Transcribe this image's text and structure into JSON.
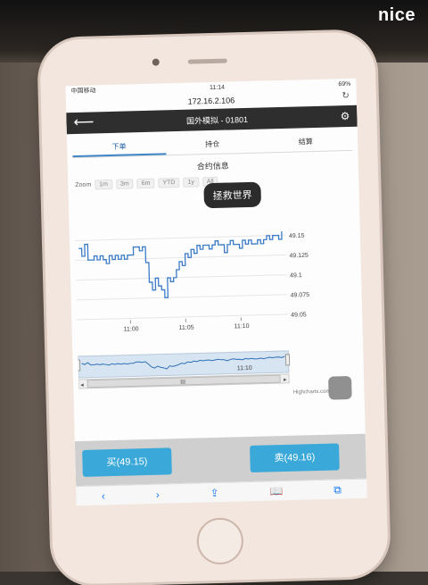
{
  "overlay": {
    "nice_label": "nice"
  },
  "status": {
    "carrier": "中国移动",
    "time": "11:14",
    "battery": "69%"
  },
  "browser": {
    "url": "172.16.2.106"
  },
  "app": {
    "title": "国外模拟 - 01801",
    "back_icon": "arrow-left-icon",
    "settings_icon": "gear-icon"
  },
  "tabs": [
    {
      "label": "下单",
      "active": true
    },
    {
      "label": "持仓",
      "active": false
    },
    {
      "label": "结算",
      "active": false
    }
  ],
  "chart_data": {
    "type": "line",
    "title": "合约信息",
    "zoom_label": "Zoom",
    "zoom_buttons": [
      "1m",
      "3m",
      "6m",
      "YTD",
      "1y",
      "All"
    ],
    "x_ticks": [
      "11:00",
      "11:05",
      "11:10"
    ],
    "y_ticks": [
      49.15,
      49.125,
      49.1,
      49.075,
      49.05
    ],
    "ylim": [
      49.05,
      49.155
    ],
    "navigator_label": "11:10",
    "credits": "Highcharts.com",
    "series": [
      {
        "values": [
          49.14,
          49.13,
          49.145,
          49.125,
          49.125,
          49.13,
          49.125,
          49.13,
          49.125,
          49.12,
          49.13,
          49.125,
          49.13,
          49.125,
          49.13,
          49.125,
          49.13,
          49.13,
          49.14,
          49.14,
          49.135,
          49.14,
          49.12,
          49.095,
          49.085,
          49.1,
          49.09,
          49.085,
          49.075,
          49.1,
          49.095,
          49.1,
          49.11,
          49.12,
          49.115,
          49.13,
          49.125,
          49.135,
          49.13,
          49.14,
          49.135,
          49.14,
          49.14,
          49.135,
          49.14,
          49.145,
          49.14,
          49.14,
          49.13,
          49.14,
          49.145,
          49.14,
          49.14,
          49.135,
          49.145,
          49.14,
          49.145,
          49.14,
          49.14,
          49.145,
          49.14,
          49.145,
          49.15,
          49.145,
          49.15,
          49.15,
          49.145,
          49.155
        ]
      }
    ],
    "grid": true
  },
  "actions": {
    "buy_label": "买(49.15)",
    "sell_label": "卖(49.16)"
  },
  "tooltip": {
    "text": "拯救世界"
  },
  "safari_toolbar": [
    "back-icon",
    "forward-icon",
    "share-icon",
    "bookmarks-icon",
    "tabs-icon"
  ]
}
